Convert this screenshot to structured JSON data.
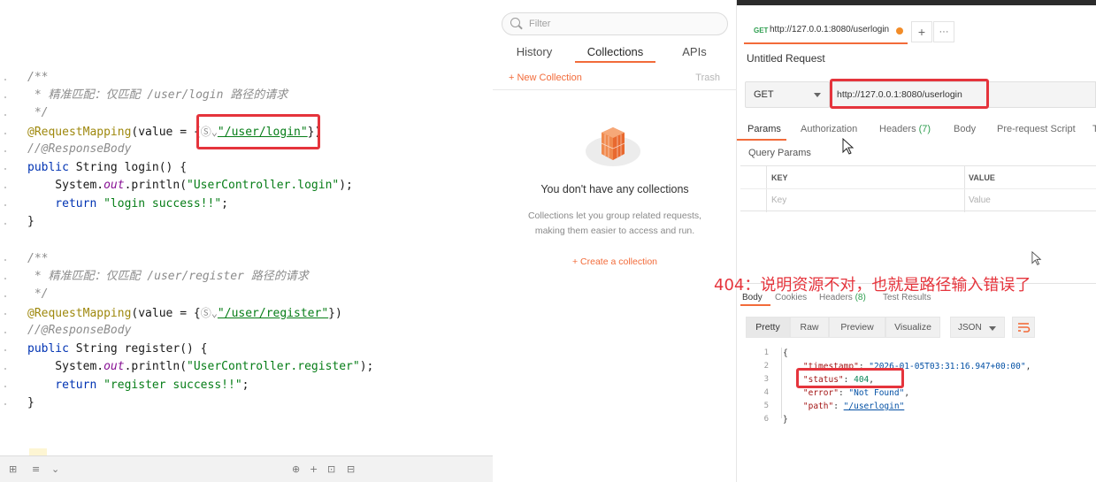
{
  "editor": {
    "block1": {
      "doc_open": "/**",
      "doc_body": " * 精准匹配：仅匹配 /user/login 路径的请求",
      "doc_close": " */",
      "annotation": "@RequestMapping",
      "annotation_args_pre": "(value = {",
      "path_hint": "Ⓢ⌄",
      "path": "\"/user/login\"",
      "annotation_args_post": "})",
      "commented_annotation": "//@ResponseBody",
      "sig_public": "public",
      "sig_rest": " String login() {",
      "print_pre": "    System.",
      "print_out": "out",
      "print_mid": ".println(",
      "print_str": "\"UserController.login\"",
      "print_post": ");",
      "return_kw": "    return",
      "return_str": " \"login success!!\"",
      "return_post": ";",
      "close": "}"
    },
    "block2": {
      "doc_open": "/**",
      "doc_body": " * 精准匹配：仅匹配 /user/register 路径的请求",
      "doc_close": " */",
      "annotation": "@RequestMapping",
      "annotation_args_pre": "(value = {",
      "path_hint": "Ⓢ⌄",
      "path": "\"/user/register\"",
      "annotation_args_post": "})",
      "commented_annotation": "//@ResponseBody",
      "sig_public": "public",
      "sig_rest": " String register() {",
      "print_pre": "    System.",
      "print_out": "out",
      "print_mid": ".println(",
      "print_str": "\"UserController.register\"",
      "print_post": ");",
      "return_kw": "    return",
      "return_str": " \"register success!!\"",
      "return_post": ";",
      "close": "}"
    }
  },
  "sidebar": {
    "filter_placeholder": "Filter",
    "tabs": [
      "History",
      "Collections",
      "APIs"
    ],
    "new_collection": "+ New Collection",
    "trash": "Trash",
    "empty_title": "You don't have any collections",
    "empty_desc_line1": "Collections let you group related requests,",
    "empty_desc_line2": "making them easier to access and run.",
    "create_collection": "+ Create a collection"
  },
  "request": {
    "tab_method": "GET",
    "tab_url": "http://127.0.0.1:8080/userlogin",
    "title": "Untitled Request",
    "method": "GET",
    "url": "http://127.0.0.1:8080/userlogin",
    "subtabs": {
      "params": "Params",
      "authorization": "Authorization",
      "headers": "Headers",
      "headers_count": "(7)",
      "body": "Body",
      "prerequest": "Pre-request Script",
      "tests_cut": "T"
    },
    "query_params_label": "Query Params",
    "table_key": "KEY",
    "table_value": "VALUE",
    "key_placeholder": "Key",
    "value_placeholder": "Value"
  },
  "response": {
    "tabs": {
      "body": "Body",
      "cookies": "Cookies",
      "headers": "Headers",
      "headers_count": "(8)",
      "test_results": "Test Results"
    },
    "format_buttons": [
      "Pretty",
      "Raw",
      "Preview",
      "Visualize"
    ],
    "format": "JSON",
    "line_numbers": [
      "1",
      "2",
      "3",
      "4",
      "5",
      "6"
    ],
    "json": {
      "open": "{",
      "timestamp_key": "\"timestamp\"",
      "timestamp_val": "\"2026-01-05T03:31:16.947+00:00\"",
      "status_key": "\"status\"",
      "status_val": "404",
      "error_key": "\"error\"",
      "error_val": "\"Not Found\"",
      "path_key": "\"path\"",
      "path_val": "\"/userlogin\"",
      "close": "}"
    }
  },
  "annotation_text": "404：说明资源不对，也就是路径输入错误了",
  "colors": {
    "accent": "#f26b3a",
    "highlight_box": "#e5343c",
    "annotation": "#e5343c"
  }
}
